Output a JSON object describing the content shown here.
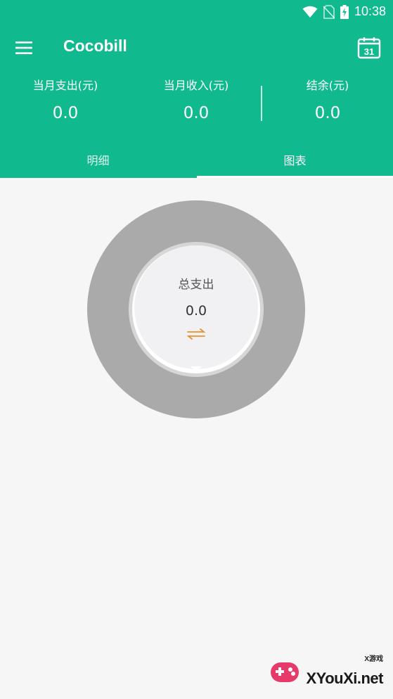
{
  "status_bar": {
    "time": "10:38"
  },
  "toolbar": {
    "title": "Cocobill",
    "menu_icon": "hamburger-menu-icon",
    "calendar_icon": "calendar-icon",
    "calendar_day": "31"
  },
  "summary": {
    "expense": {
      "label": "当月支出(元)",
      "value": "0.0"
    },
    "income": {
      "label": "当月收入(元)",
      "value": "0.0"
    },
    "balance": {
      "label": "结余(元)",
      "value": "0.0"
    }
  },
  "tabs": [
    {
      "label": "明细",
      "active": false
    },
    {
      "label": "图表",
      "active": true
    }
  ],
  "chart": {
    "center_label": "总支出",
    "center_value": "0.0",
    "toggle_icon": "swap-arrows-icon"
  },
  "chart_data": {
    "type": "pie",
    "categories": [],
    "values": [],
    "total_label": "总支出",
    "total": 0.0
  },
  "watermark": {
    "badge": "X游戏",
    "text": "XYouXi.net"
  },
  "colors": {
    "primary": "#11b98f",
    "donut": "#aaaaaa",
    "background": "#f6f6f6",
    "accent": "#e8912c"
  }
}
